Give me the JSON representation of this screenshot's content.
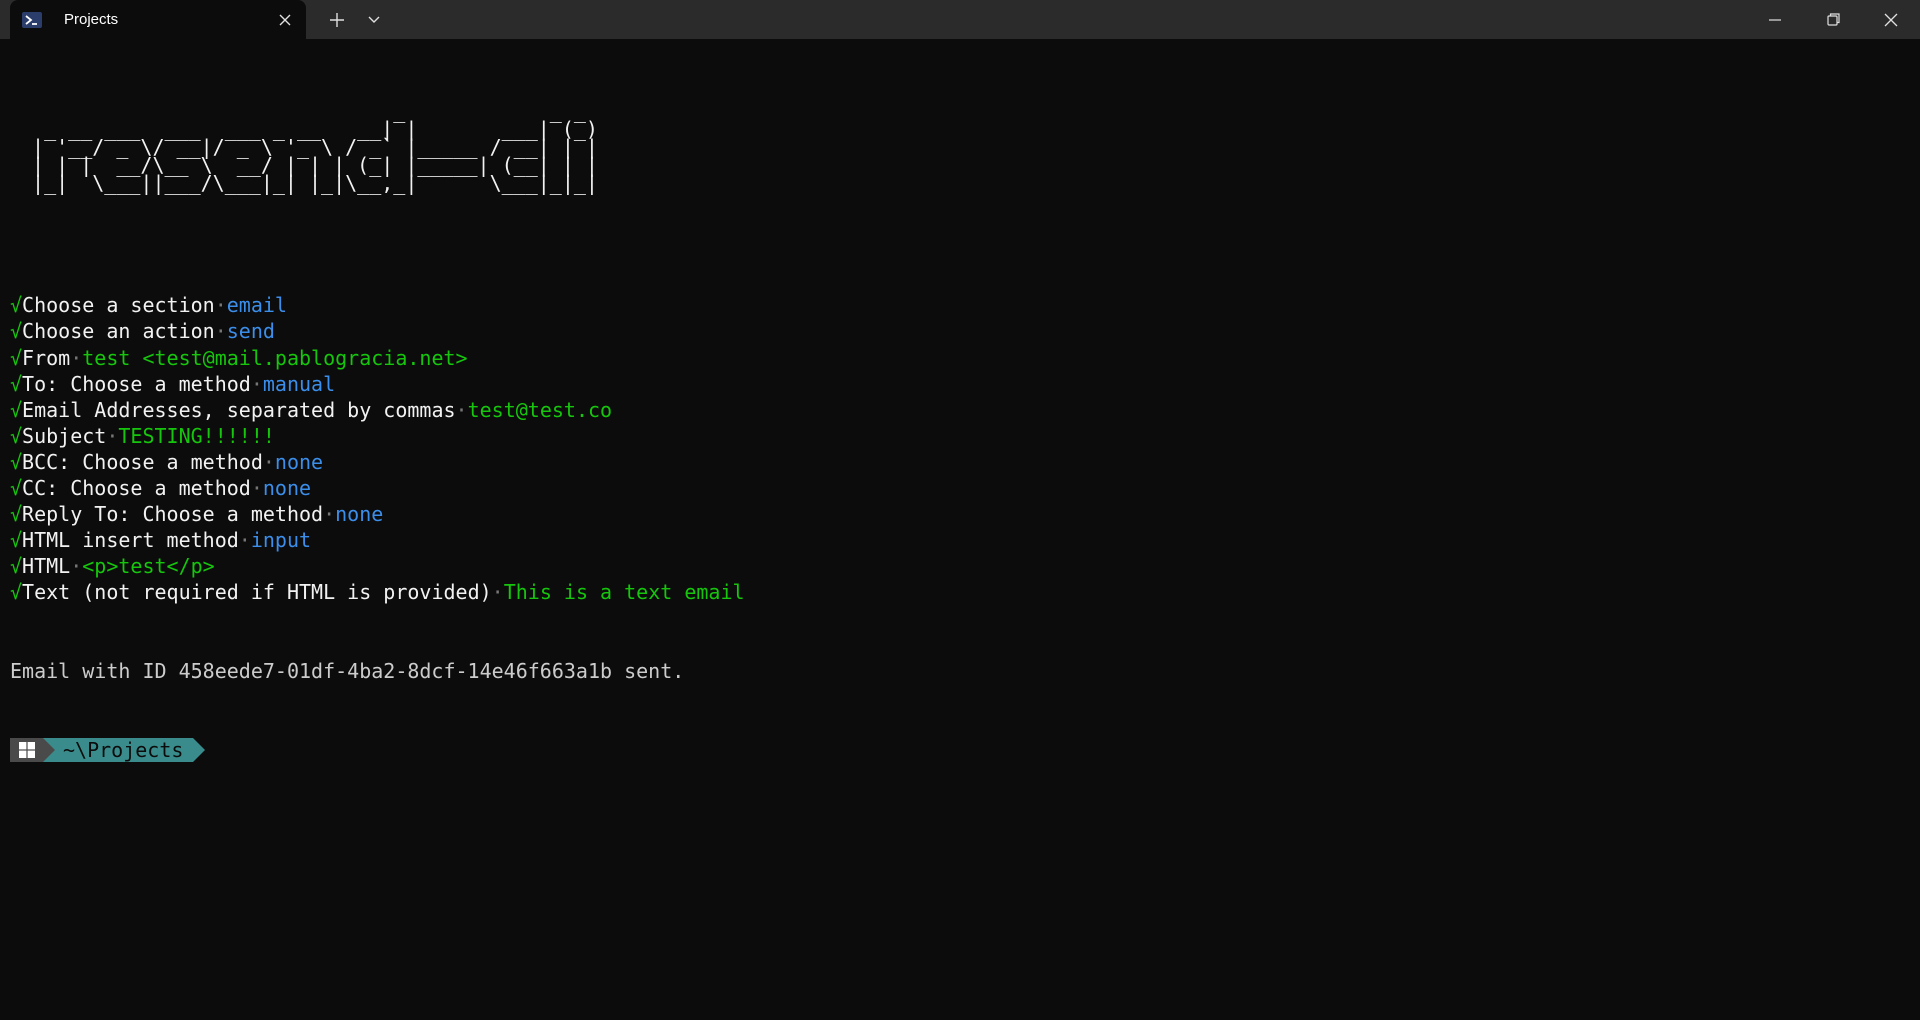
{
  "window": {
    "tab_title": "Projects",
    "new_tab_label": "+",
    "icons": {
      "tab": "powershell-icon",
      "close_tab": "close-icon",
      "dropdown": "chevron-down-icon",
      "minimize": "minimize-icon",
      "restore": "restore-icon",
      "close": "close-icon"
    }
  },
  "terminal": {
    "ascii_banner": "                               _            _ _\n  _ __ ___  ___  ___ _ __   __| |       ___| (_)\n | '__/ _ \\/ __|/ _ \\ '_ \\ / _` |_____ / __| | |\n | | |  __/\\__ \\  __/ | | | (_| |_____| (__| | |\n |_|  \\___||___/\\___|_| |_|\\__,_|      \\___|_|_|",
    "check_mark": "√",
    "separator": "·",
    "entries": [
      {
        "label": "Choose a section",
        "value": "email",
        "color": "blue"
      },
      {
        "label": "Choose an action",
        "value": "send",
        "color": "blue"
      },
      {
        "label": "From",
        "value": "test <test@mail.pablogracia.net>",
        "color": "green"
      },
      {
        "label": "To: Choose a method",
        "value": "manual",
        "color": "blue"
      },
      {
        "label": "Email Addresses, separated by commas",
        "value": "test@test.co",
        "color": "green"
      },
      {
        "label": "Subject",
        "value": "TESTING!!!!!!",
        "color": "green"
      },
      {
        "label": "BCC: Choose a method",
        "value": "none",
        "color": "blue"
      },
      {
        "label": "CC: Choose a method",
        "value": "none",
        "color": "blue"
      },
      {
        "label": "Reply To: Choose a method",
        "value": "none",
        "color": "blue"
      },
      {
        "label": "HTML insert method",
        "value": "input",
        "color": "blue"
      },
      {
        "label": "HTML",
        "value": "<p>test</p>",
        "color": "green"
      },
      {
        "label": "Text (not required if HTML is provided)",
        "value": "This is a text email",
        "color": "green"
      }
    ],
    "result": "Email with ID 458eede7-01df-4ba2-8dcf-14e46f663a1b sent.",
    "prompt_path": "~\\Projects"
  },
  "colors": {
    "background": "#0c0c0c",
    "titlebar": "#2b2b2b",
    "check": "#16c60c",
    "value_blue": "#3b8eea",
    "value_green": "#16c60c",
    "prompt_path_bg": "#3a8c8c"
  }
}
